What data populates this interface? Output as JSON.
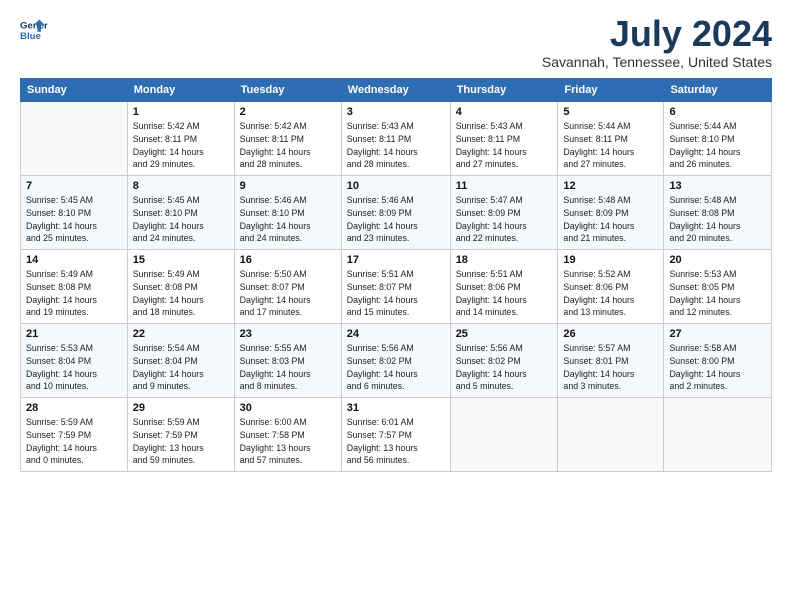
{
  "header": {
    "logo_line1": "General",
    "logo_line2": "Blue",
    "title": "July 2024",
    "subtitle": "Savannah, Tennessee, United States"
  },
  "days_of_week": [
    "Sunday",
    "Monday",
    "Tuesday",
    "Wednesday",
    "Thursday",
    "Friday",
    "Saturday"
  ],
  "weeks": [
    [
      {
        "day": "",
        "info": ""
      },
      {
        "day": "1",
        "info": "Sunrise: 5:42 AM\nSunset: 8:11 PM\nDaylight: 14 hours\nand 29 minutes."
      },
      {
        "day": "2",
        "info": "Sunrise: 5:42 AM\nSunset: 8:11 PM\nDaylight: 14 hours\nand 28 minutes."
      },
      {
        "day": "3",
        "info": "Sunrise: 5:43 AM\nSunset: 8:11 PM\nDaylight: 14 hours\nand 28 minutes."
      },
      {
        "day": "4",
        "info": "Sunrise: 5:43 AM\nSunset: 8:11 PM\nDaylight: 14 hours\nand 27 minutes."
      },
      {
        "day": "5",
        "info": "Sunrise: 5:44 AM\nSunset: 8:11 PM\nDaylight: 14 hours\nand 27 minutes."
      },
      {
        "day": "6",
        "info": "Sunrise: 5:44 AM\nSunset: 8:10 PM\nDaylight: 14 hours\nand 26 minutes."
      }
    ],
    [
      {
        "day": "7",
        "info": "Sunrise: 5:45 AM\nSunset: 8:10 PM\nDaylight: 14 hours\nand 25 minutes."
      },
      {
        "day": "8",
        "info": "Sunrise: 5:45 AM\nSunset: 8:10 PM\nDaylight: 14 hours\nand 24 minutes."
      },
      {
        "day": "9",
        "info": "Sunrise: 5:46 AM\nSunset: 8:10 PM\nDaylight: 14 hours\nand 24 minutes."
      },
      {
        "day": "10",
        "info": "Sunrise: 5:46 AM\nSunset: 8:09 PM\nDaylight: 14 hours\nand 23 minutes."
      },
      {
        "day": "11",
        "info": "Sunrise: 5:47 AM\nSunset: 8:09 PM\nDaylight: 14 hours\nand 22 minutes."
      },
      {
        "day": "12",
        "info": "Sunrise: 5:48 AM\nSunset: 8:09 PM\nDaylight: 14 hours\nand 21 minutes."
      },
      {
        "day": "13",
        "info": "Sunrise: 5:48 AM\nSunset: 8:08 PM\nDaylight: 14 hours\nand 20 minutes."
      }
    ],
    [
      {
        "day": "14",
        "info": "Sunrise: 5:49 AM\nSunset: 8:08 PM\nDaylight: 14 hours\nand 19 minutes."
      },
      {
        "day": "15",
        "info": "Sunrise: 5:49 AM\nSunset: 8:08 PM\nDaylight: 14 hours\nand 18 minutes."
      },
      {
        "day": "16",
        "info": "Sunrise: 5:50 AM\nSunset: 8:07 PM\nDaylight: 14 hours\nand 17 minutes."
      },
      {
        "day": "17",
        "info": "Sunrise: 5:51 AM\nSunset: 8:07 PM\nDaylight: 14 hours\nand 15 minutes."
      },
      {
        "day": "18",
        "info": "Sunrise: 5:51 AM\nSunset: 8:06 PM\nDaylight: 14 hours\nand 14 minutes."
      },
      {
        "day": "19",
        "info": "Sunrise: 5:52 AM\nSunset: 8:06 PM\nDaylight: 14 hours\nand 13 minutes."
      },
      {
        "day": "20",
        "info": "Sunrise: 5:53 AM\nSunset: 8:05 PM\nDaylight: 14 hours\nand 12 minutes."
      }
    ],
    [
      {
        "day": "21",
        "info": "Sunrise: 5:53 AM\nSunset: 8:04 PM\nDaylight: 14 hours\nand 10 minutes."
      },
      {
        "day": "22",
        "info": "Sunrise: 5:54 AM\nSunset: 8:04 PM\nDaylight: 14 hours\nand 9 minutes."
      },
      {
        "day": "23",
        "info": "Sunrise: 5:55 AM\nSunset: 8:03 PM\nDaylight: 14 hours\nand 8 minutes."
      },
      {
        "day": "24",
        "info": "Sunrise: 5:56 AM\nSunset: 8:02 PM\nDaylight: 14 hours\nand 6 minutes."
      },
      {
        "day": "25",
        "info": "Sunrise: 5:56 AM\nSunset: 8:02 PM\nDaylight: 14 hours\nand 5 minutes."
      },
      {
        "day": "26",
        "info": "Sunrise: 5:57 AM\nSunset: 8:01 PM\nDaylight: 14 hours\nand 3 minutes."
      },
      {
        "day": "27",
        "info": "Sunrise: 5:58 AM\nSunset: 8:00 PM\nDaylight: 14 hours\nand 2 minutes."
      }
    ],
    [
      {
        "day": "28",
        "info": "Sunrise: 5:59 AM\nSunset: 7:59 PM\nDaylight: 14 hours\nand 0 minutes."
      },
      {
        "day": "29",
        "info": "Sunrise: 5:59 AM\nSunset: 7:59 PM\nDaylight: 13 hours\nand 59 minutes."
      },
      {
        "day": "30",
        "info": "Sunrise: 6:00 AM\nSunset: 7:58 PM\nDaylight: 13 hours\nand 57 minutes."
      },
      {
        "day": "31",
        "info": "Sunrise: 6:01 AM\nSunset: 7:57 PM\nDaylight: 13 hours\nand 56 minutes."
      },
      {
        "day": "",
        "info": ""
      },
      {
        "day": "",
        "info": ""
      },
      {
        "day": "",
        "info": ""
      }
    ]
  ]
}
